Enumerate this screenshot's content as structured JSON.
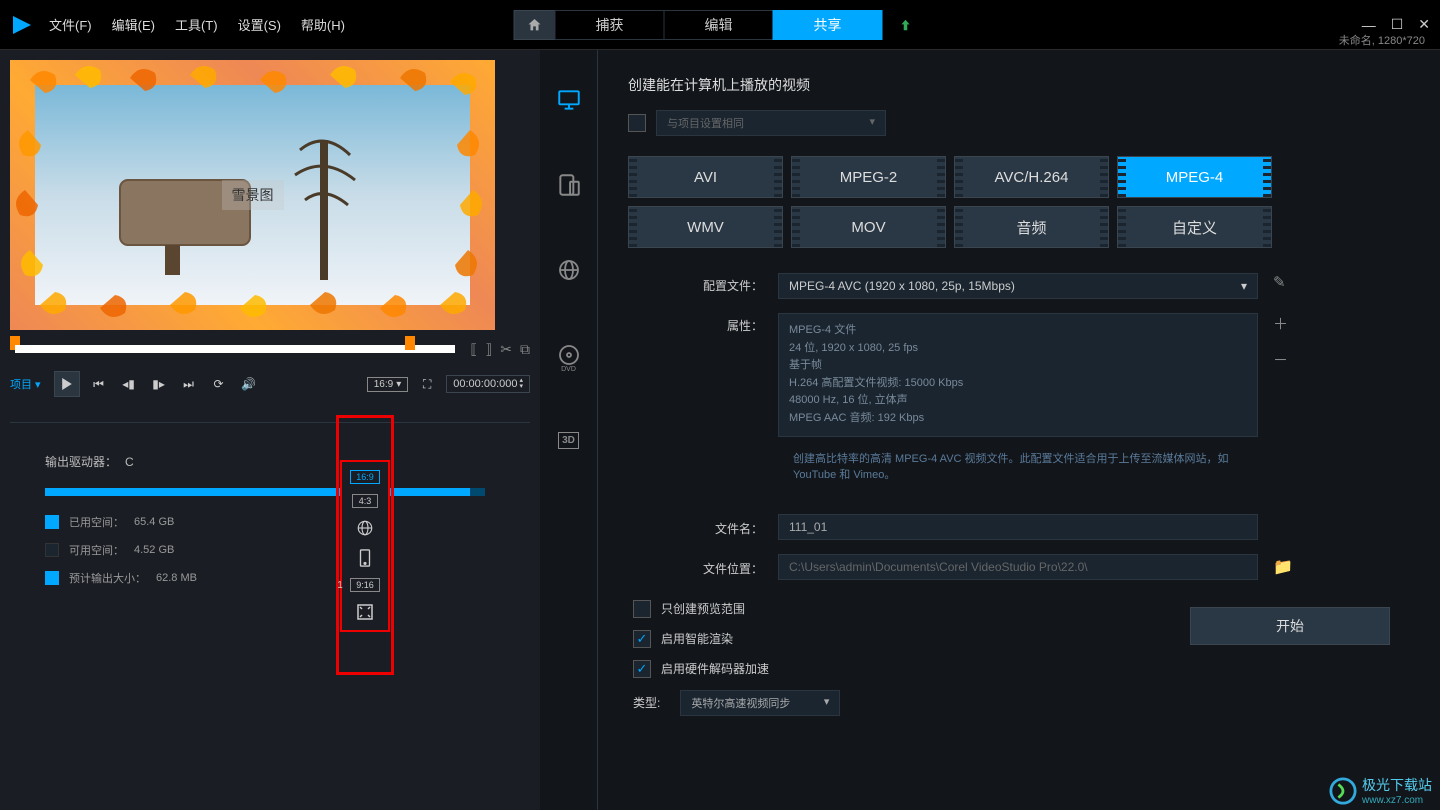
{
  "menu": {
    "file": "文件(F)",
    "edit": "编辑(E)",
    "tools": "工具(T)",
    "settings": "设置(S)",
    "help": "帮助(H)"
  },
  "tabs": {
    "capture": "捕获",
    "edit": "编辑",
    "share": "共享"
  },
  "window": {
    "status": "未命名, 1280*720"
  },
  "preview": {
    "caption": "雪景图"
  },
  "controls": {
    "project": "项目 ▾",
    "ratio": "16:9",
    "timecode": "00:00:00:000"
  },
  "ratio_menu": {
    "r169": "16:9",
    "r43": "4:3",
    "r916": "9:16",
    "r916num": "1"
  },
  "output": {
    "drive_label": "输出驱动器：",
    "drive_value": "C",
    "used_label": "已用空间：",
    "used_value": "65.4 GB",
    "avail_label": "可用空间：",
    "avail_value": "4.52 GB",
    "est_label": "预计输出大小：",
    "est_value": "62.8 MB"
  },
  "share": {
    "title": "创建能在计算机上播放的视频",
    "same_as_project": "与项目设置相同",
    "formats": {
      "avi": "AVI",
      "mpeg2": "MPEG-2",
      "avc": "AVC/H.264",
      "mpeg4": "MPEG-4",
      "wmv": "WMV",
      "mov": "MOV",
      "audio": "音频",
      "custom": "自定义"
    },
    "profile_label": "配置文件：",
    "profile_value": "MPEG-4 AVC (1920 x 1080, 25p, 15Mbps)",
    "props_label": "属性：",
    "props": {
      "l1": "MPEG-4 文件",
      "l2": "24 位, 1920 x 1080, 25 fps",
      "l3": "基于帧",
      "l4": "H.264 高配置文件视频: 15000 Kbps",
      "l5": "48000 Hz, 16 位, 立体声",
      "l6": "MPEG AAC 音频: 192 Kbps"
    },
    "desc": "创建高比特率的高清 MPEG-4 AVC 视频文件。此配置文件适合用于上传至流媒体网站，如 YouTube 和 Vimeo。",
    "filename_label": "文件名：",
    "filename_value": "111_01",
    "filepath_label": "文件位置：",
    "filepath_value": "C:\\Users\\admin\\Documents\\Corel VideoStudio Pro\\22.0\\",
    "opt_preview": "只创建预览范围",
    "opt_smart": "启用智能渲染",
    "opt_hw": "启用硬件解码器加速",
    "type_label": "类型:",
    "type_value": "英特尔高速视频同步",
    "start": "开始"
  },
  "watermark": {
    "text": "极光下载站",
    "url": "www.xz7.com"
  }
}
